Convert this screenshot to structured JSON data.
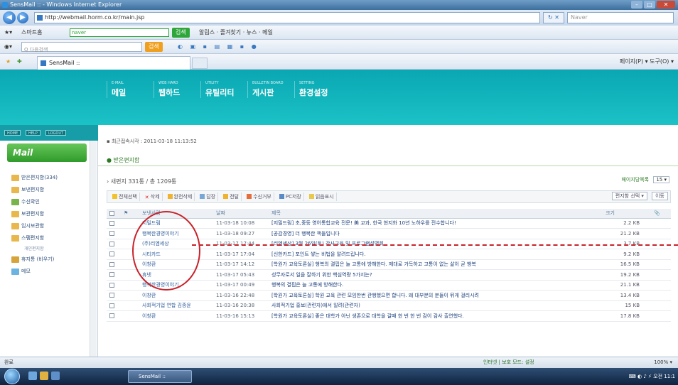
{
  "window": {
    "title": "SensMail :: - Windows Internet Explorer"
  },
  "browser": {
    "url": "http://webmail.horm.co.kr/main.jsp",
    "search_placeholder": "Naver",
    "tab_title": "SensMail ::",
    "toolbar1": {
      "home": "스마트홈",
      "naver_box": "naver",
      "search_btn": "검색",
      "shortcuts": "알림스 · 즐겨찾기 · 뉴스 · 메일",
      "extras": ""
    },
    "toolbar2": {
      "search_placeholder": "Q 다음검색",
      "search_btn": "검색"
    },
    "cmd_right": "페이지(P) ▾  도구(O) ▾"
  },
  "app": {
    "top_nav": [
      {
        "small": "E-MAIL",
        "label": "메일"
      },
      {
        "small": "WEB HARD",
        "label": "웹하드"
      },
      {
        "small": "UTILITY",
        "label": "유틸리티"
      },
      {
        "small": "BULLETIN BOARD",
        "label": "게시판"
      },
      {
        "small": "SETTING",
        "label": "환경설정"
      }
    ],
    "side_buttons": [
      "HOME",
      "HELP",
      "LOGOUT"
    ],
    "mail_banner": "Mail",
    "folders": [
      {
        "label": "받은편지함(334)"
      },
      {
        "label": "보낸편지함"
      },
      {
        "label": "수신확인"
      },
      {
        "label": "보관편지함"
      },
      {
        "label": "임시보관함"
      },
      {
        "label": "스팸편지함"
      },
      {
        "label": "개인편지함",
        "sub": true
      },
      {
        "label": "휴지통 (비우기)"
      },
      {
        "label": "메모"
      }
    ],
    "last_login": "최근접속시각 : 2011-03-18 11:13:52",
    "section_title": "받은편지함",
    "count_text": "새편지 331통 / 총 1209통",
    "per_page_label": "페이지당목록",
    "per_page_value": "15 ▾",
    "actions": [
      "전체선택",
      "삭제",
      "완전삭제",
      "답장",
      "전달",
      "수신거부",
      "PC저장",
      "읽음표시"
    ],
    "folder_select": "편지함 선택 ▾",
    "move_btn": "이동",
    "columns": [
      "",
      "",
      "보낸사람",
      "날짜",
      "제목",
      "크기",
      ""
    ],
    "rows": [
      {
        "sender": "지밀드림",
        "date": "11-03-18 10:08",
        "subject": "[지밀드림] 초,중등 영어통합교육 전문! 美 교과, 한국 현지화 10년 노하우를 전수합니다!",
        "size": "2.2 KB"
      },
      {
        "sender": "행복한경영이야기",
        "date": "11-03-18 09:27",
        "subject": "[공감경영] 더 행복한 책들입니다",
        "size": "21.2 KB"
      },
      {
        "sender": "(주)리엠세상",
        "date": "11-03-17 17:44",
        "subject": "[리엠세상] 3월 26일(토) 강사교육 및 프로그램설명회",
        "size": "3.7 KB"
      },
      {
        "sender": "시티카드",
        "date": "11-03-17 17:04",
        "subject": "[신한카드] 포인트 쌓는 비법을 알려드립니다.",
        "size": "9.2 KB"
      },
      {
        "sender": "이창환",
        "date": "11-03-17 14:12",
        "subject": "[학원가 교육토론실] 행복의 결핍은 늘 고통에 방해한다. 제대로 가득하고 고통이 없는 삶이 곧 행복",
        "size": "16.5 KB"
      },
      {
        "sender": "휴넷",
        "date": "11-03-17 05:43",
        "subject": "성무자로서 일을 잘하기 위한 핵심역량 5가지는?",
        "size": "19.2 KB"
      },
      {
        "sender": "행복한경영이야기",
        "date": "11-03-17 00:49",
        "subject": "행복의 결핍은 늘 고통에 방해한다.",
        "size": "21.1 KB"
      },
      {
        "sender": "이창환",
        "date": "11-03-16 22:48",
        "subject": "[학원가 교육토론실] 학원 교육 관련 모임한번 관행했으면 합니다. 왜 대부분의 분들이 뒤게 걸리시려",
        "size": "13.4 KB"
      },
      {
        "sender": "사회적기업 연합 김종윤",
        "date": "11-03-16 20:38",
        "subject": "사회적기업 홍보(관련자)에서 알려(관련자)",
        "size": "15 KB"
      },
      {
        "sender": "이창환",
        "date": "11-03-16 15:13",
        "subject": "[학원가 교육토론실] 좋은 대학가 아닌 생존으로 대학을 갈때 한 번 한 번 감이 감사 출연했다.",
        "size": "17.8 KB"
      }
    ]
  },
  "statusbar": {
    "left": "완료",
    "zone": "인터넷 | 보호 모드: 설정",
    "zoom": "100% ▾"
  },
  "taskbar": {
    "task": "SensMail ::",
    "clock": "오전 11:1"
  }
}
